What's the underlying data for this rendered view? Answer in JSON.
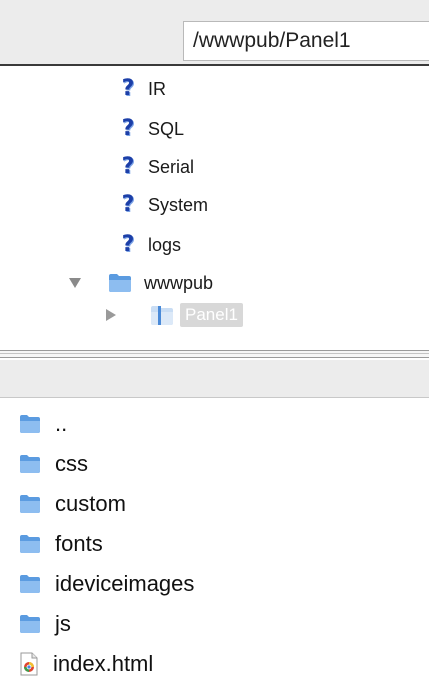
{
  "path": {
    "value": "/wwwpub/Panel1"
  },
  "tree": {
    "items": [
      {
        "label": "IR",
        "icon": "unknown-icon"
      },
      {
        "label": "SQL",
        "icon": "unknown-icon"
      },
      {
        "label": "Serial",
        "icon": "unknown-icon"
      },
      {
        "label": "System",
        "icon": "unknown-icon"
      },
      {
        "label": "logs",
        "icon": "unknown-icon"
      }
    ],
    "expanded": {
      "label": "wwwpub",
      "icon": "folder-icon",
      "state": "expanded"
    },
    "selected": {
      "label": "Panel1",
      "icon": "folder-icon",
      "state": "collapsed"
    }
  },
  "files": [
    {
      "name": "..",
      "icon": "folder-icon"
    },
    {
      "name": "css",
      "icon": "folder-icon"
    },
    {
      "name": "custom",
      "icon": "folder-icon"
    },
    {
      "name": "fonts",
      "icon": "folder-icon"
    },
    {
      "name": "ideviceimages",
      "icon": "folder-icon"
    },
    {
      "name": "js",
      "icon": "folder-icon"
    },
    {
      "name": "index.html",
      "icon": "html-file-icon"
    }
  ],
  "colors": {
    "folder": "#5b9be0",
    "unknown_icon": "#1c3fa8",
    "selection": "#d8d8d8"
  }
}
